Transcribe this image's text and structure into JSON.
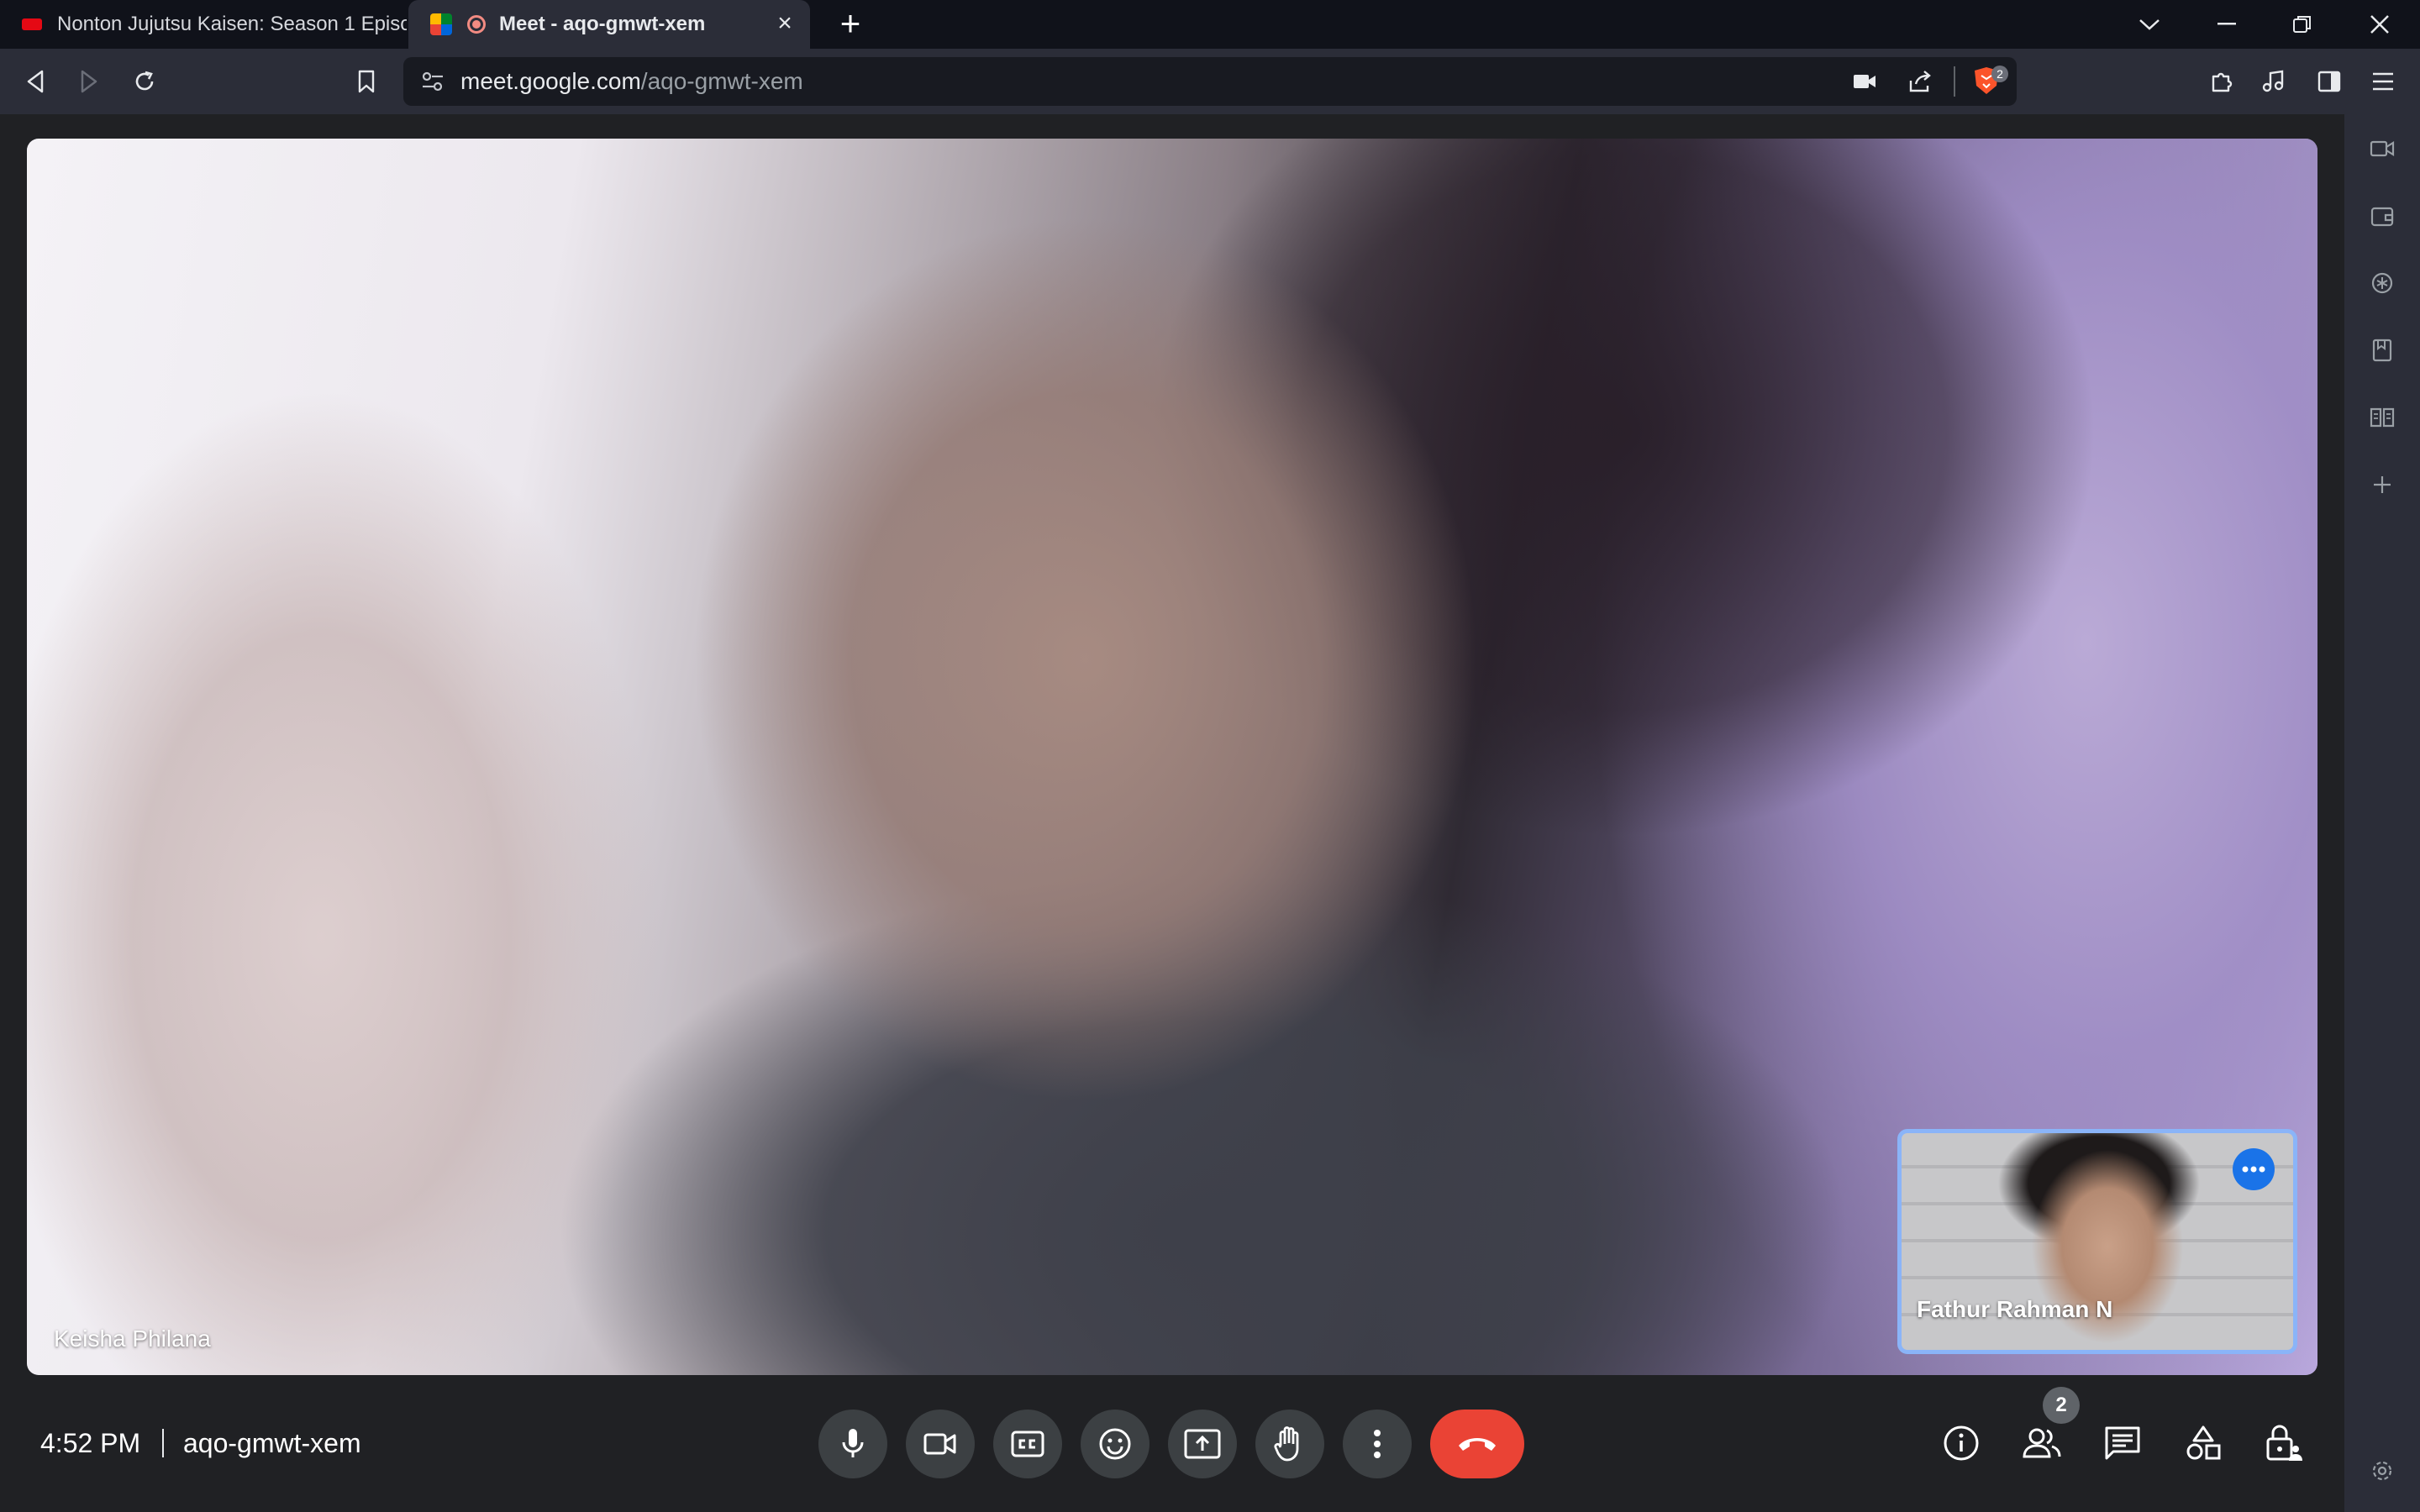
{
  "browser": {
    "tabs": [
      {
        "label": "Nonton Jujutsu Kaisen: Season 1 Episo",
        "active": false
      },
      {
        "label": "Meet - aqo-gmwt-xem",
        "active": true
      }
    ],
    "url_host": "meet.google.com",
    "url_path": "/aqo-gmwt-xem",
    "brave_shield_count": "2"
  },
  "meet": {
    "main_participant": "Keisha Philana",
    "self_participant": "Fathur Rahman N",
    "time": "4:52 PM",
    "meeting_code": "aqo-gmwt-xem",
    "people_count": "2"
  },
  "colors": {
    "end_call": "#ea4335",
    "self_view_border": "#8ab4f8",
    "more_options_button": "#1a73e8",
    "control_background": "#3c4043",
    "recording_indicator": "#f28b82"
  }
}
